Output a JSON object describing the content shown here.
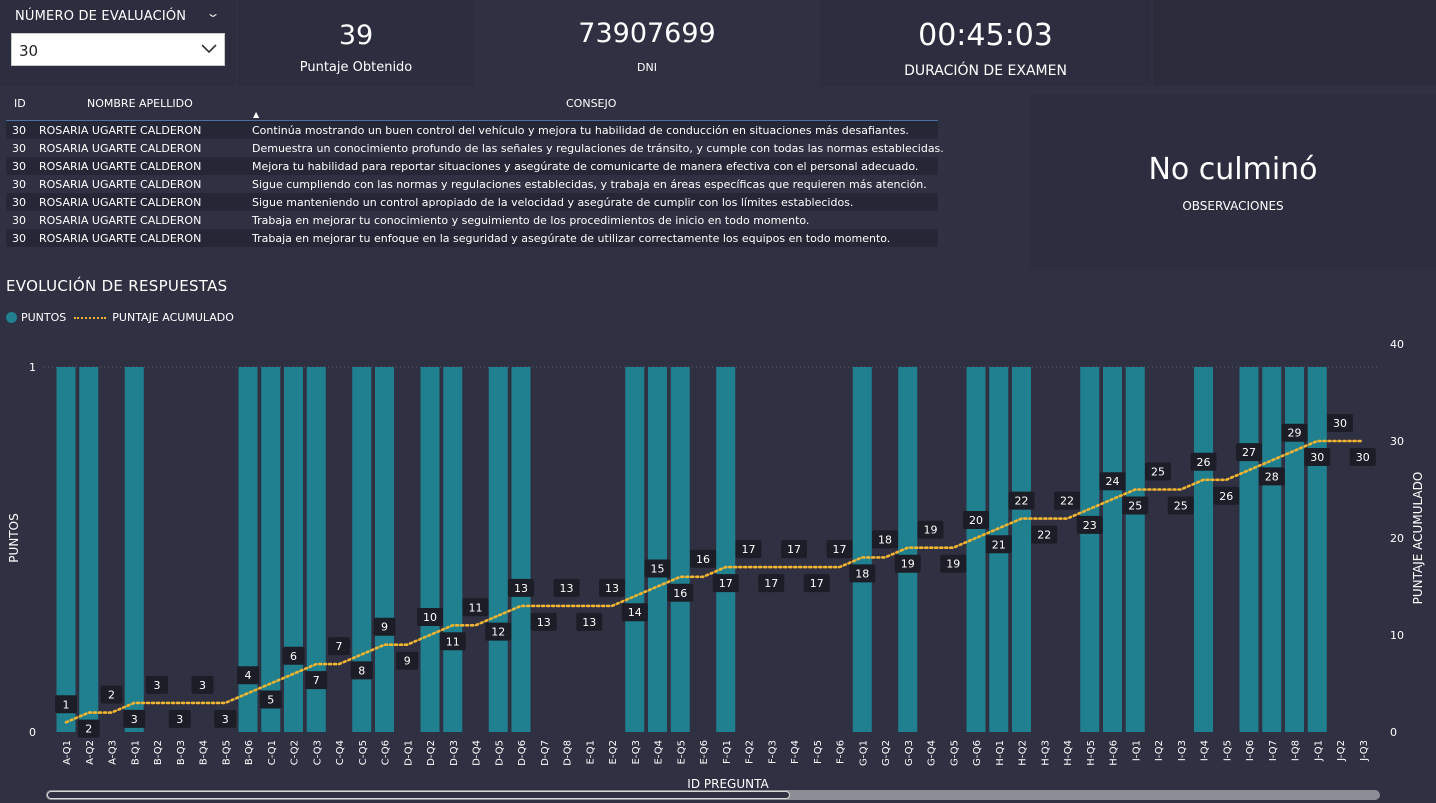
{
  "filter": {
    "label": "NÚMERO DE EVALUACIÓN",
    "selected": "30"
  },
  "kpis": {
    "score": {
      "value": "39",
      "label": "Puntaje Obtenido"
    },
    "dni": {
      "value": "73907699",
      "label": "DNI"
    },
    "duration": {
      "value": "00:45:03",
      "label": "DURACIÓN DE EXAMEN"
    }
  },
  "table": {
    "headers": {
      "id": "ID",
      "name": "NOMBRE APELLIDO",
      "tip": "CONSEJO"
    },
    "rows": [
      {
        "id": "30",
        "name": "ROSARIA UGARTE CALDERON",
        "tip": "Continúa mostrando un buen control del vehículo y mejora tu habilidad de conducción en situaciones más desafiantes."
      },
      {
        "id": "30",
        "name": "ROSARIA UGARTE CALDERON",
        "tip": "Demuestra un conocimiento profundo de las señales y regulaciones de tránsito, y cumple con todas las normas establecidas."
      },
      {
        "id": "30",
        "name": "ROSARIA UGARTE CALDERON",
        "tip": "Mejora tu habilidad para reportar situaciones y asegúrate de comunicarte de manera efectiva con el personal adecuado."
      },
      {
        "id": "30",
        "name": "ROSARIA UGARTE CALDERON",
        "tip": "Sigue cumpliendo con las normas y regulaciones establecidas, y trabaja en áreas específicas que requieren más atención."
      },
      {
        "id": "30",
        "name": "ROSARIA UGARTE CALDERON",
        "tip": "Sigue manteniendo un control apropiado de la velocidad y asegúrate de cumplir con los límites establecidos."
      },
      {
        "id": "30",
        "name": "ROSARIA UGARTE CALDERON",
        "tip": "Trabaja en mejorar tu conocimiento y seguimiento de los procedimientos de inicio en todo momento."
      },
      {
        "id": "30",
        "name": "ROSARIA UGARTE CALDERON",
        "tip": "Trabaja en mejorar tu enfoque en la seguridad y asegúrate de utilizar correctamente los equipos en todo momento."
      }
    ]
  },
  "observation": {
    "value": "No culminó",
    "label": "OBSERVACIONES"
  },
  "chart": {
    "title": "EVOLUCIÓN DE RESPUESTAS",
    "legend": {
      "points": "PUNTOS",
      "cumulative": "PUNTAJE ACUMULADO"
    },
    "colors": {
      "bar": "#21808f",
      "line": "#f2b531",
      "label_bg": "#1c1d26",
      "grid": "#5c5f6e"
    }
  },
  "chart_data": {
    "type": "bar",
    "xlabel": "ID PREGUNTA",
    "ylabel": "PUNTOS",
    "y2label": "PUNTAJE ACUMULADO",
    "ylim": [
      0,
      1
    ],
    "y2lim": [
      0,
      40
    ],
    "yticks": [
      "0",
      "1"
    ],
    "y2ticks": [
      "0",
      "10",
      "20",
      "30",
      "40"
    ],
    "categories": [
      "A-Q1",
      "A-Q2",
      "A-Q3",
      "B-Q1",
      "B-Q2",
      "B-Q3",
      "B-Q4",
      "B-Q5",
      "B-Q6",
      "C-Q1",
      "C-Q2",
      "C-Q3",
      "C-Q4",
      "C-Q5",
      "C-Q6",
      "D-Q1",
      "D-Q2",
      "D-Q3",
      "D-Q4",
      "D-Q5",
      "D-Q6",
      "D-Q7",
      "D-Q8",
      "E-Q1",
      "E-Q2",
      "E-Q3",
      "E-Q4",
      "E-Q5",
      "E-Q6",
      "F-Q1",
      "F-Q2",
      "F-Q3",
      "F-Q4",
      "F-Q5",
      "F-Q6",
      "G-Q1",
      "G-Q2",
      "G-Q3",
      "G-Q4",
      "G-Q5",
      "G-Q6",
      "H-Q1",
      "H-Q2",
      "H-Q3",
      "H-Q4",
      "H-Q5",
      "H-Q6",
      "I-Q1",
      "I-Q2",
      "I-Q3",
      "I-Q4",
      "I-Q5",
      "I-Q6",
      "I-Q7",
      "I-Q8",
      "J-Q1",
      "J-Q2",
      "J-Q3"
    ],
    "series": [
      {
        "name": "PUNTOS",
        "type": "bar",
        "values": [
          1,
          1,
          0,
          1,
          0,
          0,
          0,
          0,
          1,
          1,
          1,
          1,
          0,
          1,
          1,
          0,
          1,
          1,
          0,
          1,
          1,
          0,
          0,
          0,
          0,
          1,
          1,
          1,
          0,
          1,
          0,
          0,
          0,
          0,
          0,
          1,
          0,
          1,
          0,
          0,
          1,
          1,
          1,
          0,
          0,
          1,
          1,
          1,
          0,
          0,
          1,
          0,
          1,
          1,
          1,
          1,
          0,
          0
        ]
      },
      {
        "name": "PUNTAJE ACUMULADO",
        "type": "line",
        "values": [
          1,
          2,
          2,
          3,
          3,
          3,
          3,
          3,
          4,
          5,
          6,
          7,
          7,
          8,
          9,
          9,
          10,
          11,
          11,
          12,
          13,
          13,
          13,
          13,
          13,
          14,
          15,
          16,
          16,
          17,
          17,
          17,
          17,
          17,
          17,
          18,
          18,
          19,
          19,
          19,
          20,
          21,
          22,
          22,
          22,
          23,
          24,
          25,
          25,
          25,
          26,
          26,
          27,
          28,
          29,
          30,
          30,
          30
        ]
      }
    ]
  }
}
